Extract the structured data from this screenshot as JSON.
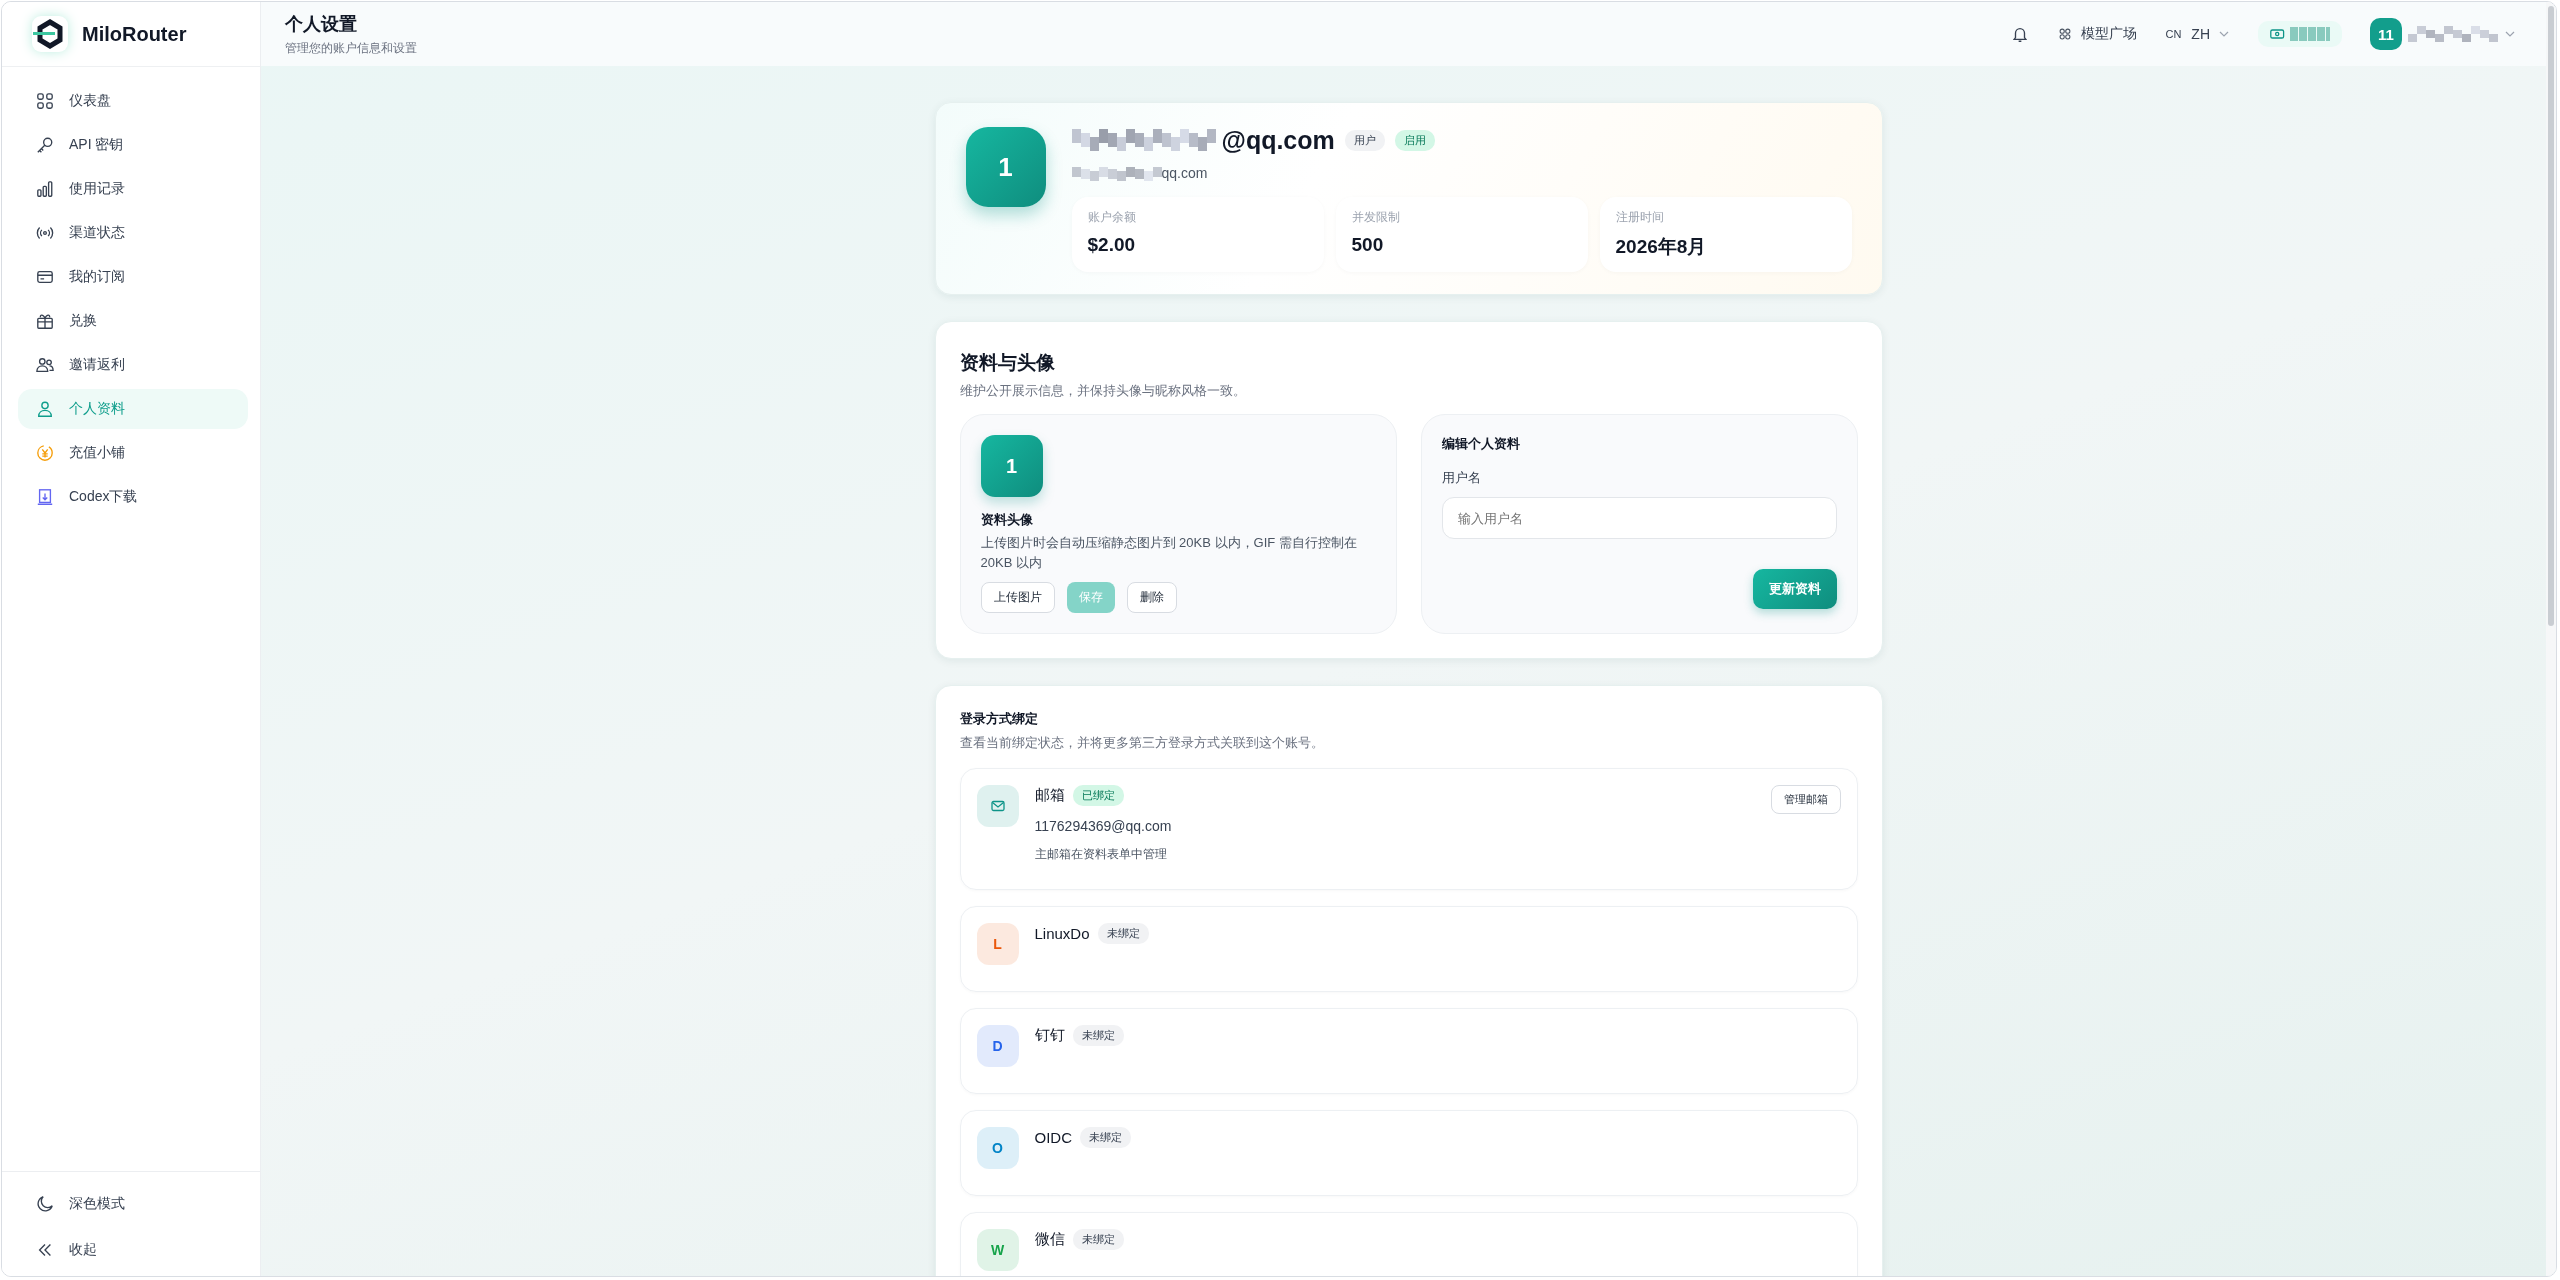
{
  "brand": {
    "name": "MiloRouter"
  },
  "sidebar": {
    "items": [
      {
        "label": "仪表盘",
        "selected": false
      },
      {
        "label": "API 密钥",
        "selected": false
      },
      {
        "label": "使用记录",
        "selected": false
      },
      {
        "label": "渠道状态",
        "selected": false
      },
      {
        "label": "我的订阅",
        "selected": false
      },
      {
        "label": "兑换",
        "selected": false
      },
      {
        "label": "邀请返利",
        "selected": false
      },
      {
        "label": "个人资料",
        "selected": true
      },
      {
        "label": "充值小铺",
        "selected": false
      },
      {
        "label": "Codex下载",
        "selected": false
      }
    ],
    "footer_items": [
      {
        "label": "深色模式"
      },
      {
        "label": "收起"
      }
    ]
  },
  "header": {
    "title": "个人设置",
    "subtitle": "管理您的账户信息和设置",
    "marketplace": "模型广场",
    "lang_code": "CN",
    "lang": "ZH",
    "user_avatar": "11"
  },
  "profile": {
    "avatar": "1",
    "email": "@qq.com",
    "role_badge": "用户",
    "status_badge": "启用",
    "subtitle": "qq.com",
    "stats": [
      {
        "label": "账户余额",
        "value": "$2.00"
      },
      {
        "label": "并发限制",
        "value": "500"
      },
      {
        "label": "注册时间",
        "value": "2026年8月"
      }
    ]
  },
  "profile_section": {
    "title": "资料与头像",
    "description": "维护公开展示信息，并保持头像与昵称风格一致。",
    "avatar_panel": {
      "avatar": "1",
      "title": "资料头像",
      "hint": "上传图片时会自动压缩静态图片到 20KB 以内，GIF 需自行控制在 20KB 以内",
      "buttons": [
        {
          "label": "上传图片",
          "kind": "outline",
          "disabled": false
        },
        {
          "label": "保存",
          "kind": "primary",
          "disabled": true
        },
        {
          "label": "删除",
          "kind": "outline",
          "disabled": false
        }
      ]
    },
    "edit_panel": {
      "title": "编辑个人资料",
      "field_label": "用户名",
      "placeholder": "输入用户名",
      "submit": "更新资料"
    }
  },
  "bindings": {
    "title": "登录方式绑定",
    "description": "查看当前绑定状态，并将更多第三方登录方式关联到这个账号。",
    "items": [
      {
        "kind": "email",
        "name": "邮箱",
        "bound": true,
        "status": "已绑定",
        "color": "#0d9488",
        "detail": "1176294369@qq.com",
        "note": "主邮箱在资料表单中管理",
        "action": "管理邮箱"
      },
      {
        "kind": "letter",
        "letter": "L",
        "name": "LinuxDo",
        "bound": false,
        "status": "未绑定",
        "color": "#ea580c"
      },
      {
        "kind": "letter",
        "letter": "D",
        "name": "钉钉",
        "bound": false,
        "status": "未绑定",
        "color": "#2563eb"
      },
      {
        "kind": "letter",
        "letter": "O",
        "name": "OIDC",
        "bound": false,
        "status": "未绑定",
        "color": "#0284c7"
      },
      {
        "kind": "letter",
        "letter": "W",
        "name": "微信",
        "bound": false,
        "status": "未绑定",
        "color": "#16a34a"
      }
    ]
  }
}
